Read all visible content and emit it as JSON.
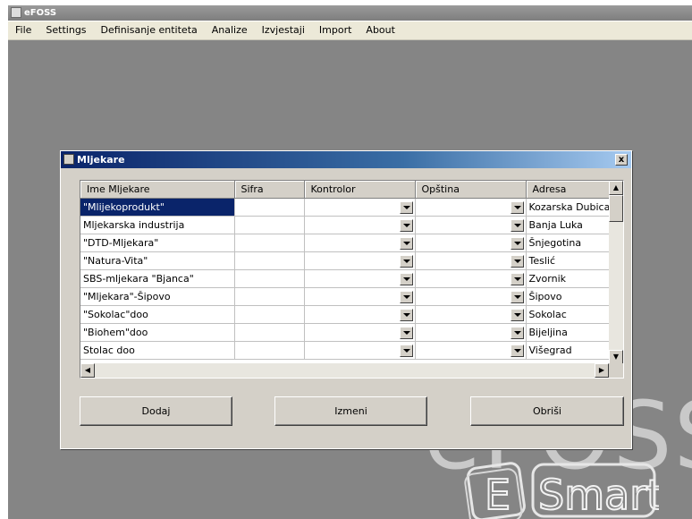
{
  "app": {
    "title": "eFOSS"
  },
  "menu": [
    "File",
    "Settings",
    "Definisanje entiteta",
    "Analize",
    "Izvjestaji",
    "Import",
    "About"
  ],
  "dialog": {
    "title": "Mljekare",
    "close_label": "x",
    "columns": [
      "Ime Mljekare",
      "Sifra",
      "Kontrolor",
      "Opština",
      "Adresa"
    ],
    "rows": [
      {
        "name": "\"Mlijekoprodukt\"",
        "sifra": "",
        "kontrolor": "",
        "opstina": "",
        "adresa": "Kozarska Dubica",
        "selected": true
      },
      {
        "name": "Mljekarska industrija",
        "sifra": "",
        "kontrolor": "",
        "opstina": "",
        "adresa": "Banja Luka"
      },
      {
        "name": "\"DTD-Mljekara\"",
        "sifra": "",
        "kontrolor": "",
        "opstina": "",
        "adresa": "Šnjegotina"
      },
      {
        "name": "\"Natura-Vita\"",
        "sifra": "",
        "kontrolor": "",
        "opstina": "",
        "adresa": "Teslić"
      },
      {
        "name": "SBS-mljekara \"Bjanca\"",
        "sifra": "",
        "kontrolor": "",
        "opstina": "",
        "adresa": "Zvornik"
      },
      {
        "name": "\"Mljekara\"-Šipovo",
        "sifra": "",
        "kontrolor": "",
        "opstina": "",
        "adresa": "Šipovo"
      },
      {
        "name": "\"Sokolac\"doo",
        "sifra": "",
        "kontrolor": "",
        "opstina": "",
        "adresa": "Sokolac"
      },
      {
        "name": "\"Biohem\"doo",
        "sifra": "",
        "kontrolor": "",
        "opstina": "",
        "adresa": "Bijeljina"
      },
      {
        "name": "Stolac doo",
        "sifra": "",
        "kontrolor": "",
        "opstina": "",
        "adresa": "Višegrad"
      }
    ],
    "buttons": {
      "add": "Dodaj",
      "edit": "Izmeni",
      "delete": "Obriši"
    }
  },
  "background": {
    "efoss_text": "eFOSS",
    "esmart_letter": "E",
    "esmart_text": "Smart"
  },
  "icons": [
    "app-icon",
    "dialog-icon",
    "close-icon",
    "dropdown-arrow-icon",
    "scroll-up-icon",
    "scroll-down-icon",
    "scroll-left-icon",
    "scroll-right-icon"
  ],
  "colors": {
    "desktop": "#858585",
    "dialog": "#d4d0c8",
    "selection": "#0a246a"
  }
}
